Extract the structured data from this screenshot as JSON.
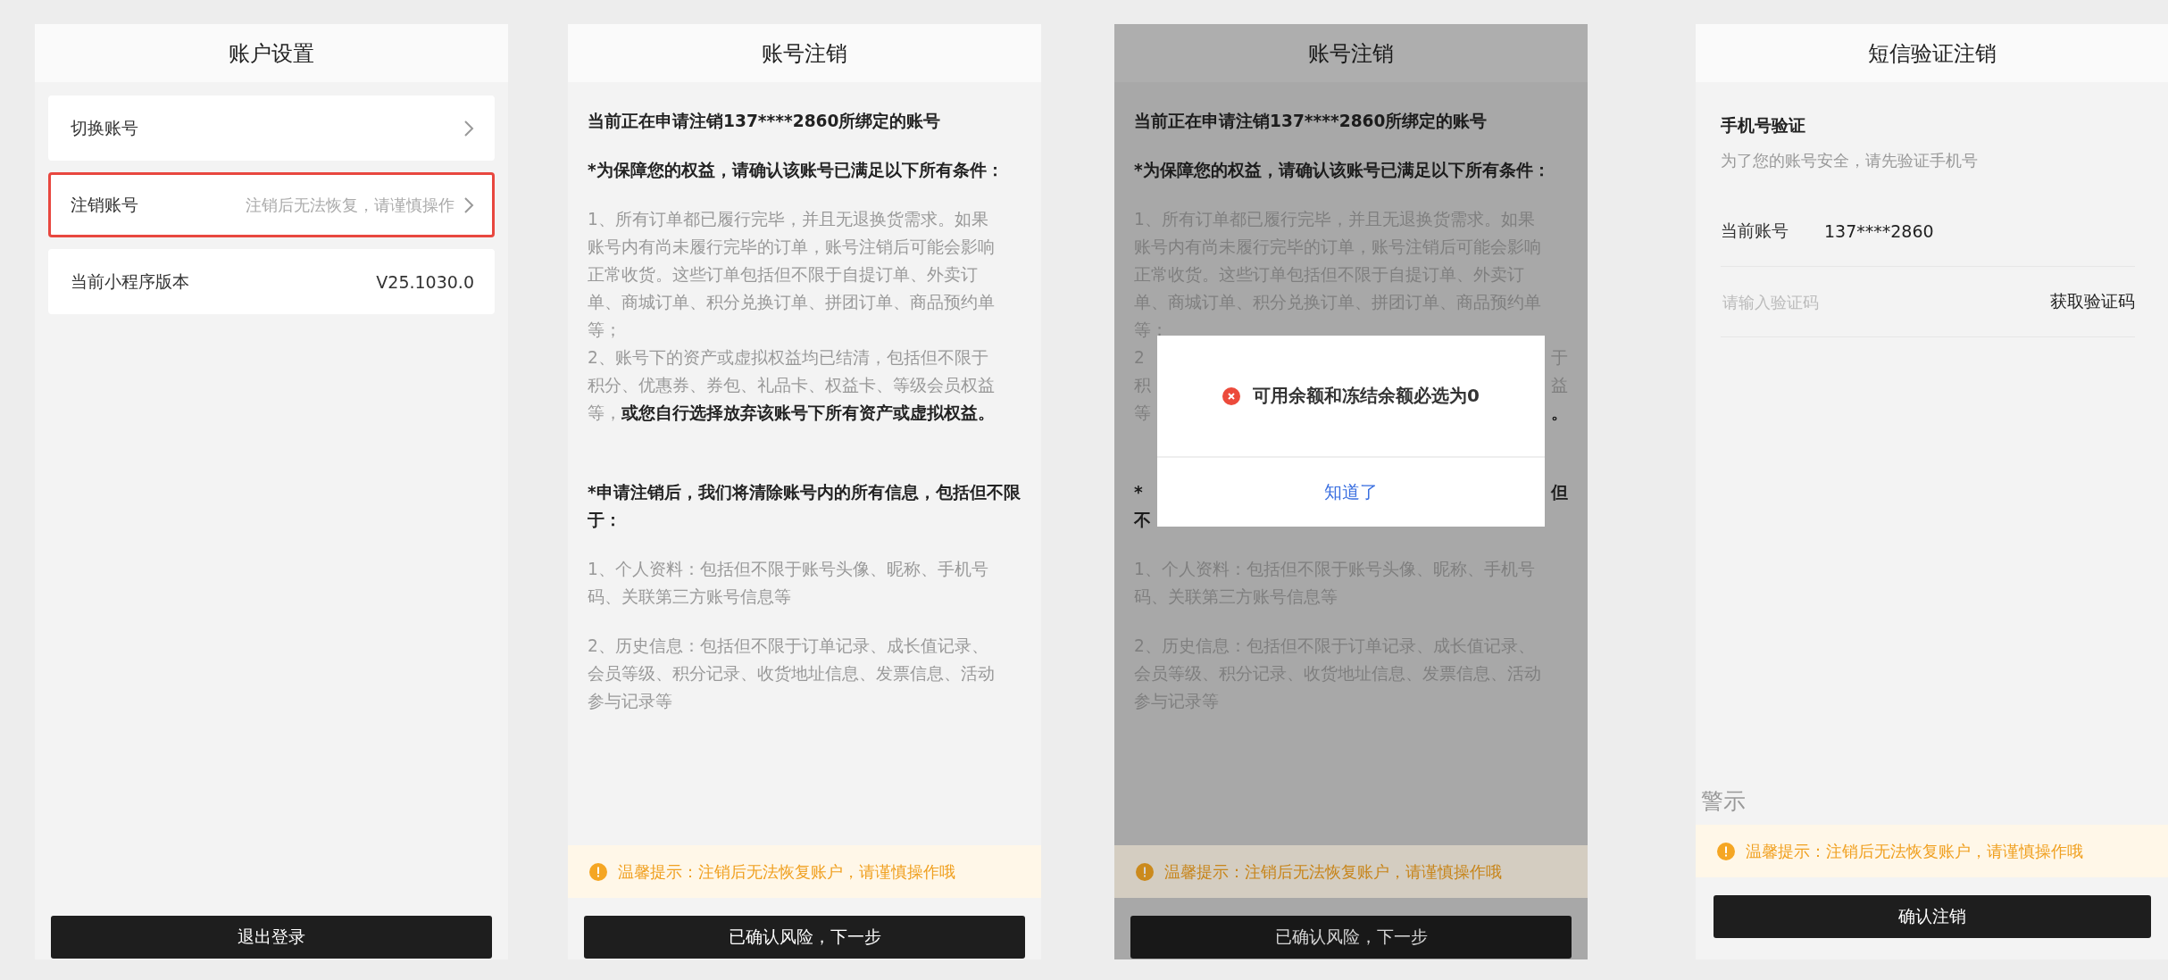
{
  "screens": [
    {
      "kind": "settings",
      "title": "账户设置",
      "items": [
        {
          "kind": "link",
          "label": "切换账号",
          "highlighted": false
        },
        {
          "kind": "link",
          "label": "注销账号",
          "hint": "注销后无法恢复，请谨慎操作",
          "highlighted": true
        },
        {
          "kind": "info",
          "label": "当前小程序版本",
          "value": "V25.1030.0",
          "highlighted": false
        }
      ],
      "button": "退出登录"
    },
    {
      "kind": "notice",
      "title": "账号注销",
      "dimmed": false,
      "blocks": [
        {
          "kind": "heading",
          "lines": [
            "当前正在申请注销137****2860所绑定的账号"
          ]
        },
        {
          "kind": "heading",
          "lines": [
            "*为保障您的权益，请确认该账号已满足以下所有条件："
          ]
        },
        {
          "kind": "body",
          "lines": [
            "1、所有订单都已履行完毕，并且无退换货需求。如果账号内有尚未履行完毕的订单，账号注销后可能会影响正常收货。这些订单包括但不限于自提订单、外卖订单、商城订单、积分兑换订单、拼团订单、商品预约单等；",
            "2、账号下的资产或虚拟权益均已结清，包括但不限于积分、优惠券、券包、礼品卡、权益卡、等级会员权益等，**或您自行选择放弃该账号下所有资产或虚拟权益。**"
          ]
        },
        {
          "kind": "heading",
          "lines": [
            "*申请注销后，我们将清除账号内的所有信息，包括但不限于："
          ]
        },
        {
          "kind": "body",
          "lines": [
            "1、个人资料：包括但不限于账号头像、昵称、手机号码、关联第三方账号信息等"
          ]
        },
        {
          "kind": "body",
          "lines": [
            "2、历史信息：包括但不限于订单记录、成长值记录、会员等级、积分记录、收货地址信息、发票信息、活动参与记录等"
          ]
        }
      ],
      "warning": "温馨提示：注销后无法恢复账户，请谨慎操作哦",
      "button": "已确认风险，下一步"
    },
    {
      "kind": "notice",
      "title": "账号注销",
      "dimmed": true,
      "blocks": [
        {
          "kind": "heading",
          "lines": [
            "当前正在申请注销137****2860所绑定的账号"
          ]
        },
        {
          "kind": "heading",
          "lines": [
            "*为保障您的权益，请确认该账号已满足以下所有条件："
          ]
        },
        {
          "kind": "body",
          "lines": [
            "1、所有订单都已履行完毕，并且无退换货需求。如果账号内有尚未履行完毕的订单，账号注销后可能会影响正常收货。这些订单包括但不限于自提订单、外卖订单、商城订单、积分兑换订单、拼团订单、商品预约单等；"
          ]
        },
        {
          "kind": "covered",
          "rows": [
            [
              {
                "text": "2",
                "bold": false
              },
              {
                "text": "于",
                "bold": false
              }
            ],
            [
              {
                "text": "积",
                "bold": false
              },
              {
                "text": "益",
                "bold": false
              }
            ],
            [
              {
                "text": "等",
                "bold": false
              },
              {
                "text": "。",
                "bold": true
              }
            ]
          ]
        },
        {
          "kind": "covered",
          "rows": [
            [
              {
                "text": "*",
                "bold": true
              },
              {
                "text": "但",
                "bold": true
              }
            ],
            [
              {
                "text": "不",
                "bold": true
              }
            ]
          ]
        },
        {
          "kind": "body",
          "lines": [
            "1、个人资料：包括但不限于账号头像、昵称、手机号码、关联第三方账号信息等"
          ]
        },
        {
          "kind": "body",
          "lines": [
            "2、历史信息：包括但不限于订单记录、成长值记录、会员等级、积分记录、收货地址信息、发票信息、活动参与记录等"
          ]
        }
      ],
      "warning": "温馨提示：注销后无法恢复账户，请谨慎操作哦",
      "button": "已确认风险，下一步",
      "dialog": {
        "message": "可用余额和冻结余额必选为0",
        "button": "知道了"
      }
    },
    {
      "kind": "verify",
      "title": "短信验证注销",
      "section_title": "手机号验证",
      "section_hint": "为了您的账号安全，请先验证手机号",
      "account_label": "当前账号",
      "account_value": "137****2860",
      "code_placeholder": "请输入验证码",
      "code_button": "获取验证码",
      "caption": "警示",
      "warning": "温馨提示：注销后无法恢复账户，请谨慎操作哦",
      "button": "确认注销"
    }
  ]
}
